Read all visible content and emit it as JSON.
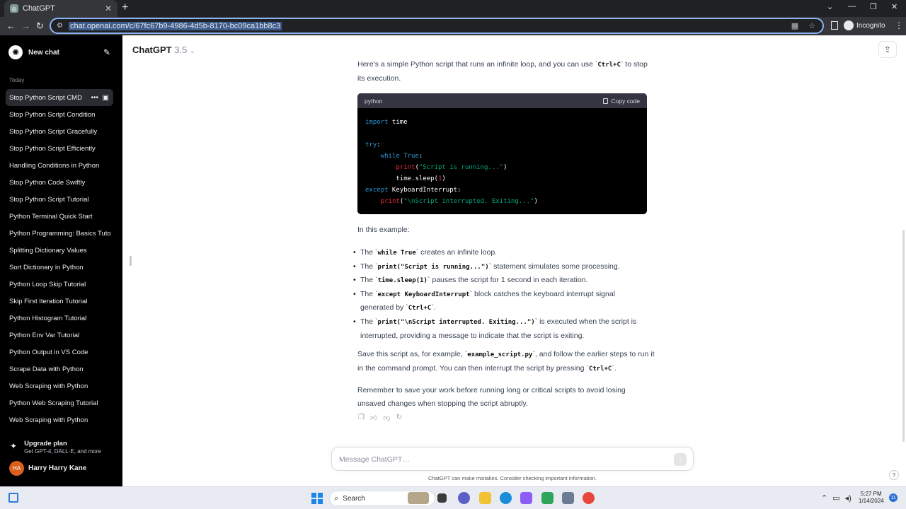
{
  "browser": {
    "tab_title": "ChatGPT",
    "url": "chat.openai.com/c/67fc67b9-4986-4d5b-8170-bc09ca1bb8c3",
    "incognito_label": "Incognito"
  },
  "sidebar": {
    "new_chat_label": "New chat",
    "section_today": "Today",
    "items": [
      {
        "label": "Stop Python Script CMD"
      },
      {
        "label": "Stop Python Script Condition"
      },
      {
        "label": "Stop Python Script Gracefully"
      },
      {
        "label": "Stop Python Script Efficiently"
      },
      {
        "label": "Handling Conditions in Python"
      },
      {
        "label": "Stop Python Code Swiftly"
      },
      {
        "label": "Stop Python Script Tutorial"
      },
      {
        "label": "Python Terminal Quick Start"
      },
      {
        "label": "Python Programming: Basics Tuto"
      },
      {
        "label": "Splitting Dictionary Values"
      },
      {
        "label": "Sort Dictionary in Python"
      },
      {
        "label": "Python Loop Skip Tutorial"
      },
      {
        "label": "Skip First Iteration Tutorial"
      },
      {
        "label": "Python Histogram Tutorial"
      },
      {
        "label": "Python Env Var Tutorial"
      },
      {
        "label": "Python Output in VS Code"
      },
      {
        "label": "Scrape Data with Python"
      },
      {
        "label": "Web Scraping with Python"
      },
      {
        "label": "Python Web Scraping Tutorial"
      },
      {
        "label": "Web Scraping with Python"
      }
    ],
    "upgrade_title": "Upgrade plan",
    "upgrade_sub": "Get GPT-4, DALL·E, and more",
    "user_initials": "HA",
    "user_name": "Harry Harry Kane"
  },
  "header": {
    "model_name": "ChatGPT",
    "model_version": "3.5"
  },
  "message": {
    "intro_a": "Here's a simple Python script that runs an infinite loop, and you can use `",
    "intro_code": "Ctrl+C",
    "intro_b": "` to stop its execution.",
    "code_lang": "python",
    "copy_label": "Copy code",
    "example_intro": "In this example:",
    "b1_pre": "The `",
    "b1_code": "while True",
    "b1_post": "` creates an infinite loop.",
    "b2_pre": "The `",
    "b2_code": "print(\"Script is running...\")",
    "b2_post": "` statement simulates some processing.",
    "b3_pre": "The `",
    "b3_code": "time.sleep(1)",
    "b3_post": "` pauses the script for 1 second in each iteration.",
    "b4_pre": "The `",
    "b4_code": "except KeyboardInterrupt",
    "b4_mid": "` block catches the keyboard interrupt signal generated by `",
    "b4_code2": "Ctrl+C",
    "b4_post": "`.",
    "b5_pre": "The `",
    "b5_code": "print(\"\\nScript interrupted. Exiting...\")",
    "b5_post": "` is executed when the script is interrupted, providing a message to indicate that the script is exiting.",
    "save_a": "Save this script as, for example, `",
    "save_code": "example_script.py",
    "save_b": "`, and follow the earlier steps to run it in the command prompt. You can then interrupt the script by pressing `",
    "save_code2": "Ctrl+C",
    "save_c": "`.",
    "remember": "Remember to save your work before running long or critical scripts to avoid losing unsaved changes when stopping the script abruptly."
  },
  "code": {
    "l1_kw": "import",
    "l1_rest": " time",
    "l3_kw": "try",
    "l3_rest": ":",
    "l4_kw": "while",
    "l4_val": "True",
    "l4_rest": ":",
    "l5_fn": "print",
    "l5_str": "\"Script is running...\"",
    "l6_pre": "time.sleep(",
    "l6_num": "1",
    "l6_post": ")",
    "l7_kw": "except",
    "l7_rest": " KeyboardInterrupt:",
    "l8_fn": "print",
    "l8_str": "\"\\nScript interrupted. Exiting...\""
  },
  "composer": {
    "placeholder": "Message ChatGPT…",
    "disclaimer": "ChatGPT can make mistakes. Consider checking important information."
  },
  "taskbar": {
    "search_label": "Search",
    "time": "5:27 PM",
    "date": "1/14/2024",
    "notification_count": "11"
  }
}
